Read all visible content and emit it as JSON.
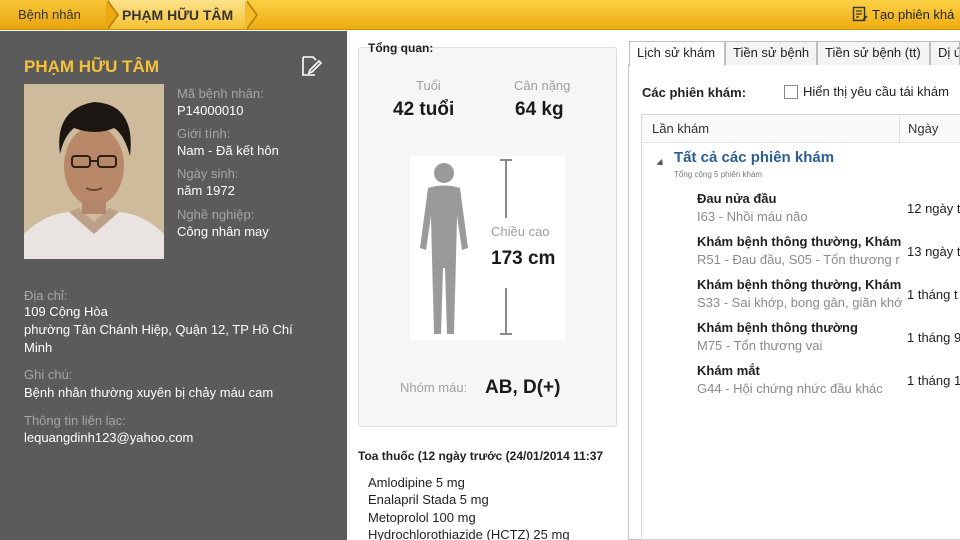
{
  "breadcrumb": {
    "home": "Bệnh nhân",
    "current": "PHẠM HỮU TÂM"
  },
  "toolbar": {
    "new_visit_label": "Tạo phiên khá"
  },
  "patient": {
    "name": "PHẠM HỮU TÂM",
    "id_label": "Mã bệnh nhân:",
    "id_value": "P14000010",
    "gender_label": "Giới tính:",
    "gender_value": "Nam - Đã kết hôn",
    "dob_label": "Ngày sinh:",
    "dob_value": "năm 1972",
    "job_label": "Nghề nghiệp:",
    "job_value": "Công nhân may",
    "address_label": "Địa chỉ:",
    "address_line1": "109 Cộng Hòa",
    "address_line2": "phường Tân Chánh Hiệp, Quận 12, TP Hồ Chí Minh",
    "note_label": "Ghi chú:",
    "note_value": "Bệnh nhân thường xuyên bị chảy máu cam",
    "contact_label": "Thông tin liên lạc:",
    "contact_value": "lequangdinh123@yahoo.com"
  },
  "overview": {
    "title": "Tổng quan:",
    "age_label": "Tuổi",
    "age_value": "42 tuổi",
    "weight_label": "Cân nặng",
    "weight_value": "64 kg",
    "height_label": "Chiều cao",
    "height_value": "173 cm",
    "blood_label": "Nhóm máu:",
    "blood_value": "AB, D(+)"
  },
  "prescription": {
    "title": "Toa thuốc (12 ngày trước (24/01/2014 11:37",
    "items": [
      "Amlodipine 5 mg",
      "Enalapril Stada 5 mg",
      "Metoprolol 100 mg",
      "Hydrochlorothiazide (HCTZ) 25 mg"
    ]
  },
  "tabs": [
    "Lịch sử khám",
    "Tiền sử bệnh",
    "Tiền sử bệnh (tt)",
    "Dị ứ"
  ],
  "history": {
    "sessions_label": "Các phiên khám:",
    "recheck_label": "Hiển thị yêu cầu tái khám",
    "col_visit": "Lần khám",
    "col_date": "Ngày",
    "group_title": "Tất cả các phiên khám",
    "group_sub": "Tổng cộng 5 phiên khám",
    "rows": [
      {
        "title": "Đau nửa đầu",
        "sub": "I63 - Nhồi máu não",
        "date": "12 ngày t"
      },
      {
        "title": "Khám bệnh thông thường, Khám",
        "sub": "R51 - Đau đầu, S05 - Tổn thương r",
        "date": "13 ngày t"
      },
      {
        "title": "Khám bệnh thông thường, Khám",
        "sub": "S33 - Sai khớp, bong gân, giãn khớ",
        "date": "1 tháng t"
      },
      {
        "title": "Khám bệnh thông thường",
        "sub": "M75 - Tổn thương vai",
        "date": "1 tháng 9"
      },
      {
        "title": "Khám mắt",
        "sub": "G44 - Hội chứng nhức đầu khác",
        "date": "1 tháng 1"
      }
    ]
  },
  "colors": {
    "accent": "#f6c23b",
    "panel": "#5b5b5b",
    "link": "#2d5d95"
  }
}
